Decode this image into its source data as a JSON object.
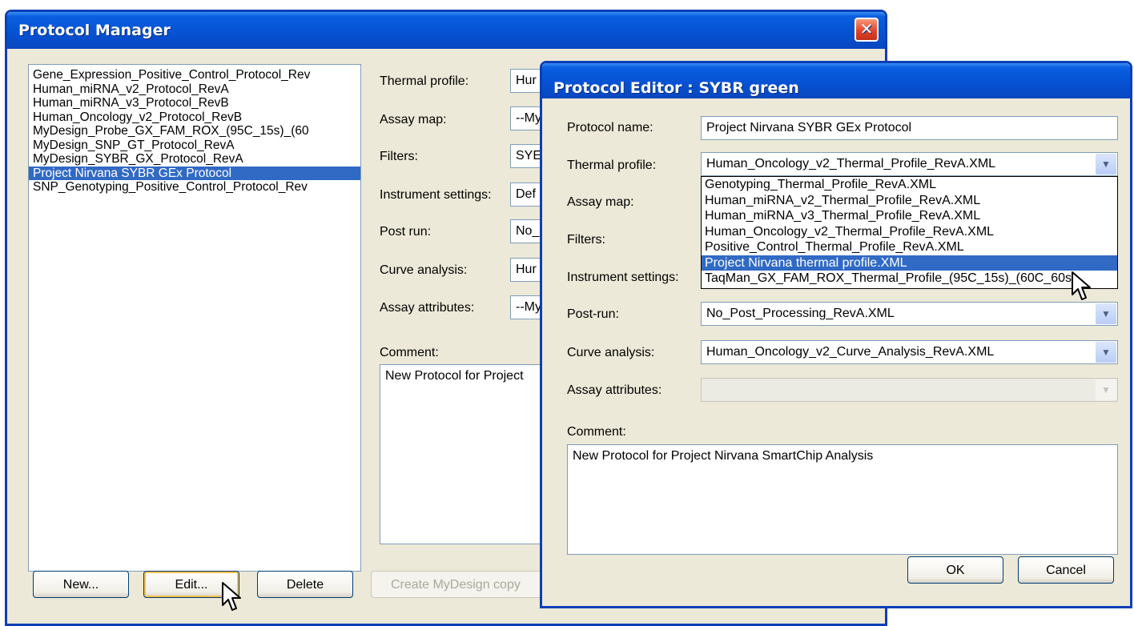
{
  "manager": {
    "title": "Protocol Manager",
    "close_glyph": "✕",
    "protocols": [
      "Gene_Expression_Positive_Control_Protocol_Rev",
      "Human_miRNA_v2_Protocol_RevA",
      "Human_miRNA_v3_Protocol_RevB",
      "Human_Oncology_v2_Protocol_RevB",
      "MyDesign_Probe_GX_FAM_ROX_(95C_15s)_(60",
      "MyDesign_SNP_GT_Protocol_RevA",
      "MyDesign_SYBR_GX_Protocol_RevA",
      "Project Nirvana SYBR GEx Protocol",
      "SNP_Genotyping_Positive_Control_Protocol_Rev"
    ],
    "selected_protocol": "Project Nirvana SYBR GEx Protocol",
    "labels": {
      "thermal": "Thermal profile:",
      "assay_map": "Assay map:",
      "filters": "Filters:",
      "instrument": "Instrument settings:",
      "post_run": "Post run:",
      "curve": "Curve analysis:",
      "assay_attr": "Assay attributes:",
      "comment": "Comment:"
    },
    "values": {
      "thermal": "Hur",
      "assay_map": "--My",
      "filters": "SYE",
      "instrument": "Def",
      "post_run": "No_",
      "curve": "Hur",
      "assay_attr": "--My"
    },
    "comment": "New Protocol for Project",
    "buttons": {
      "new": "New...",
      "edit": "Edit...",
      "delete": "Delete",
      "create_copy": "Create MyDesign copy"
    }
  },
  "editor": {
    "title": "Protocol Editor : SYBR green",
    "labels": {
      "name": "Protocol name:",
      "thermal": "Thermal profile:",
      "assay_map": "Assay map:",
      "filters": "Filters:",
      "instrument": "Instrument settings:",
      "post_run": "Post-run:",
      "curve": "Curve analysis:",
      "assay_attr": "Assay attributes:",
      "comment": "Comment:"
    },
    "protocol_name": "Project Nirvana SYBR GEx Protocol",
    "thermal_profile": "Human_Oncology_v2_Thermal_Profile_RevA.XML",
    "thermal_options": [
      "Genotyping_Thermal_Profile_RevA.XML",
      "Human_miRNA_v2_Thermal_Profile_RevA.XML",
      "Human_miRNA_v3_Thermal_Profile_RevA.XML",
      "Human_Oncology_v2_Thermal_Profile_RevA.XML",
      "Positive_Control_Thermal_Profile_RevA.XML",
      "Project Nirvana thermal profile.XML",
      "TaqMan_GX_FAM_ROX_Thermal_Profile_(95C_15s)_(60C_60s)"
    ],
    "highlighted_option": "Project Nirvana thermal profile.XML",
    "post_run": "No_Post_Processing_RevA.XML",
    "curve_analysis": "Human_Oncology_v2_Curve_Analysis_RevA.XML",
    "assay_attributes": "",
    "comment": "New Protocol for Project Nirvana SmartChip Analysis",
    "buttons": {
      "ok": "OK",
      "cancel": "Cancel"
    }
  },
  "colors": {
    "titlebar": "#0552d4",
    "selection": "#316ac5",
    "window_bg": "#ece9d8",
    "close_button": "#e0452b"
  },
  "icons": {
    "cursor": "arrow-pointer-icon",
    "dropdown": "chevron-down-icon",
    "close": "close-icon"
  }
}
